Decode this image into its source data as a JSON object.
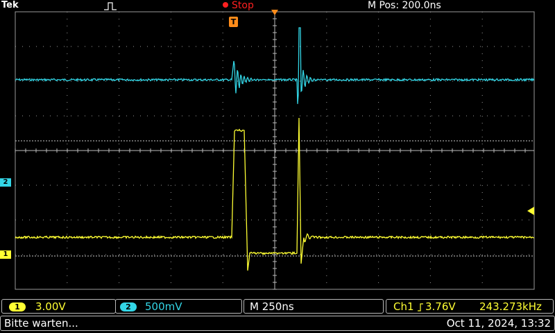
{
  "header": {
    "brand": "Tek",
    "acq_state": "Stop",
    "horizontal_position": "M Pos: 200.0ns"
  },
  "colors": {
    "ch1": "#ffff33",
    "ch2": "#33d6e6",
    "accent_orange": "#ff8c1a",
    "stop_red": "#ff2020",
    "grid": "#9a9a9a"
  },
  "channel_markers": {
    "ch1": "1",
    "ch2": "2",
    "trigger": "T"
  },
  "readouts": {
    "ch1_chip": "1",
    "ch1_scale": "3.00V",
    "ch2_chip": "2",
    "ch2_scale": "500mV",
    "timebase": "M 250ns",
    "trigger_source": "Ch1",
    "trigger_slope_icon": "rising-edge-icon",
    "trigger_level": "3.76V",
    "frequency": "243.273kHz"
  },
  "status": {
    "message": "Bitte warten...",
    "datetime": "Oct 11, 2024, 13:32"
  }
}
